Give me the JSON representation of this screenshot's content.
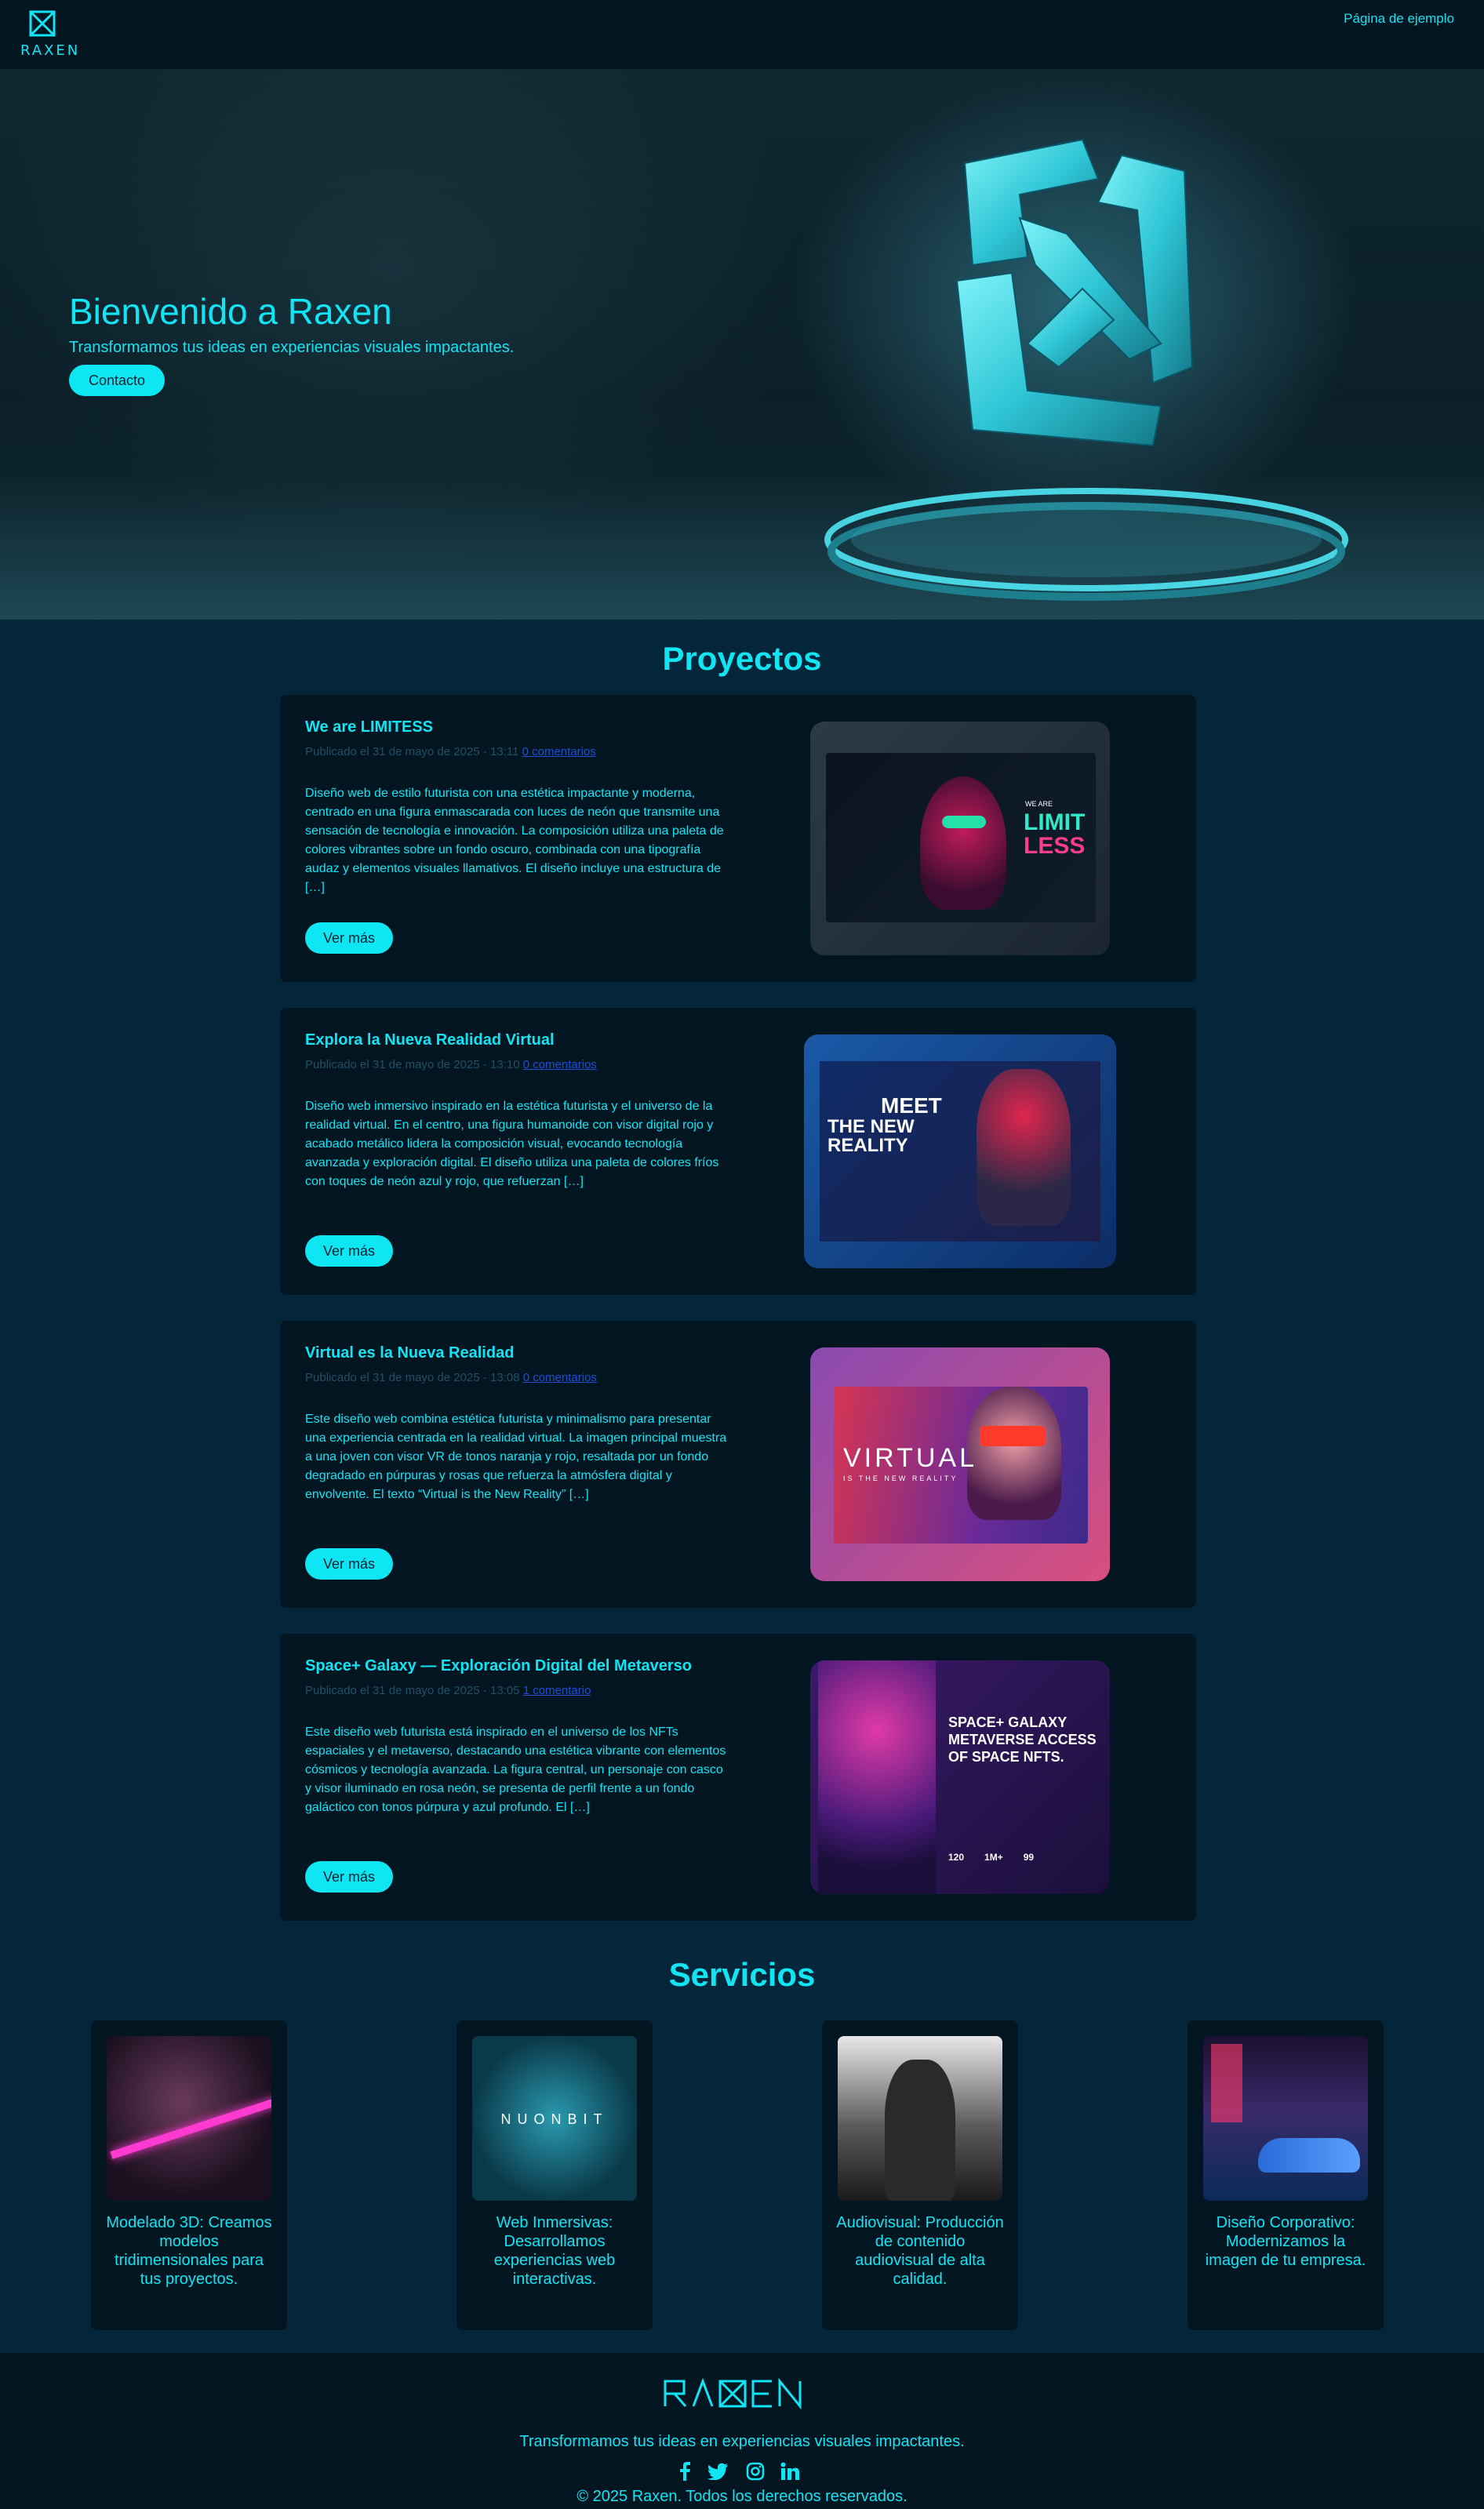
{
  "header": {
    "logo_text": "RAXEN",
    "nav_link": "Página de ejemplo"
  },
  "hero": {
    "title": "Bienvenido a Raxen",
    "subtitle": "Transformamos tus ideas en experiencias visuales impactantes.",
    "cta_label": "Contacto"
  },
  "projects": {
    "section_title": "Proyectos",
    "items": [
      {
        "title": "We are LIMITESS",
        "meta_date": "Publicado el 31 de mayo de 2025 - 13:11",
        "comments": "0 comentarios",
        "description": "Diseño web de estilo futurista con una estética impactante y moderna, centrado en una figura enmascarada con luces de neón que transmite una sensación de tecnología e innovación. La composición utiliza una paleta de colores vibrantes sobre un fondo oscuro, combinada con una tipografía audaz y elementos visuales llamativos. El diseño incluye una estructura de […]",
        "button": "Ver más",
        "image_text_1": "WE ARE",
        "image_text_2": "LIMIT",
        "image_text_3": "LESS"
      },
      {
        "title": "Explora la Nueva Realidad Virtual",
        "meta_date": "Publicado el 31 de mayo de 2025 - 13:10",
        "comments": "0 comentarios",
        "description": "Diseño web inmersivo inspirado en la estética futurista y el universo de la realidad virtual. En el centro, una figura humanoide con visor digital rojo y acabado metálico lidera la composición visual, evocando tecnología avanzada y exploración digital. El diseño utiliza una paleta de colores fríos con toques de neón azul y rojo, que refuerzan […]",
        "button": "Ver más",
        "image_text_1": "MEET",
        "image_text_2": "THE NEW",
        "image_text_3": "REALITY"
      },
      {
        "title": "Virtual es la Nueva Realidad",
        "meta_date": "Publicado el 31 de mayo de 2025 - 13:08",
        "comments": "0 comentarios",
        "description": "Este diseño web combina estética futurista y minimalismo para presentar una experiencia centrada en la realidad virtual. La imagen principal muestra a una joven con visor VR de tonos naranja y rojo, resaltada por un fondo degradado en púrpuras y rosas que refuerza la atmósfera digital y envolvente. El texto “Virtual is the New Reality” […]",
        "button": "Ver más",
        "image_text_1": "VIRTUAL",
        "image_text_2": "IS THE NEW REALITY"
      },
      {
        "title": "Space+ Galaxy — Exploración Digital del Metaverso",
        "meta_date": "Publicado el 31 de mayo de 2025 - 13:05",
        "comments": "1 comentario",
        "description": "Este diseño web futurista está inspirado en el universo de los NFTs espaciales y el metaverso, destacando una estética vibrante con elementos cósmicos y tecnología avanzada. La figura central, un personaje con casco y visor iluminado en rosa neón, se presenta de perfil frente a un fondo galáctico con tonos púrpura y azul profundo. El […]",
        "button": "Ver más",
        "image_text_1": "SPACE+ GALAXY",
        "image_text_2": "METAVERSE ACCESS",
        "image_text_3": "OF SPACE NFTS.",
        "image_stats": [
          "120",
          "1M+",
          "99"
        ]
      }
    ]
  },
  "services": {
    "section_title": "Servicios",
    "items": [
      {
        "text": "Modelado 3D: Creamos modelos tridimensionales para tus proyectos."
      },
      {
        "text": "Web Inmersivas: Desarrollamos experiencias web interactivas.",
        "image_text": "NUONBIT"
      },
      {
        "text": "Audiovisual: Producción de contenido audiovisual de alta calidad."
      },
      {
        "text": "Diseño Corporativo: Modernizamos la imagen de tu empresa."
      }
    ]
  },
  "footer": {
    "logo_text": "RAXEN",
    "tagline": "Transformamos tus ideas en experiencias visuales impactantes.",
    "social": [
      "facebook-icon",
      "twitter-icon",
      "instagram-icon",
      "linkedin-icon"
    ],
    "copyright": "© 2025 Raxen. Todos los derechos reservados."
  },
  "colors": {
    "accent": "#12e4f4",
    "background": "#03263a",
    "card": "#021621"
  }
}
